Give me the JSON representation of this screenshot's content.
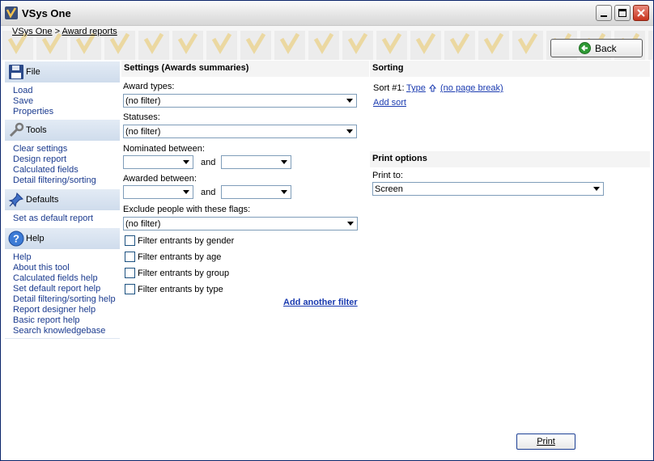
{
  "window": {
    "title": "VSys One"
  },
  "breadcrumb": {
    "root": "VSys One",
    "sep": ">",
    "current": "Award reports"
  },
  "back_button": {
    "label": "Back"
  },
  "sidebar": {
    "file": {
      "title": "File",
      "items": [
        "Load",
        "Save",
        "Properties"
      ]
    },
    "tools": {
      "title": "Tools",
      "items": [
        "Clear settings",
        "Design report",
        "Calculated fields",
        "Detail filtering/sorting"
      ]
    },
    "defaults": {
      "title": "Defaults",
      "items": [
        "Set as default report"
      ]
    },
    "help": {
      "title": "Help",
      "items": [
        "Help",
        "About this tool",
        "Calculated fields help",
        "Set default report help",
        "Detail filtering/sorting help",
        "Report designer help",
        "Basic report help",
        "Search knowledgebase"
      ]
    }
  },
  "settings": {
    "title": "Settings (Awards summaries)",
    "award_types_label": "Award types:",
    "award_types_value": "(no filter)",
    "statuses_label": "Statuses:",
    "statuses_value": "(no filter)",
    "nominated_label": "Nominated between:",
    "awarded_label": "Awarded between:",
    "and_label": "and",
    "flags_label": "Exclude people with these flags:",
    "flags_value": "(no filter)",
    "checkboxes": [
      "Filter entrants by gender",
      "Filter entrants by age",
      "Filter entrants by group",
      "Filter entrants by type"
    ],
    "add_filter": "Add another filter"
  },
  "sorting": {
    "title": "Sorting",
    "sort1_label": "Sort #1:",
    "sort1_field": "Type",
    "sort1_break": "(no page break)",
    "add_sort": "Add sort"
  },
  "print_options": {
    "title": "Print options",
    "print_to_label": "Print to:",
    "print_to_value": "Screen"
  },
  "print_button": {
    "label": "Print"
  },
  "colors": {
    "link": "#1b3bb0",
    "sidebar_header": "#d6e1ef",
    "accent_check": "#ecc45c"
  }
}
